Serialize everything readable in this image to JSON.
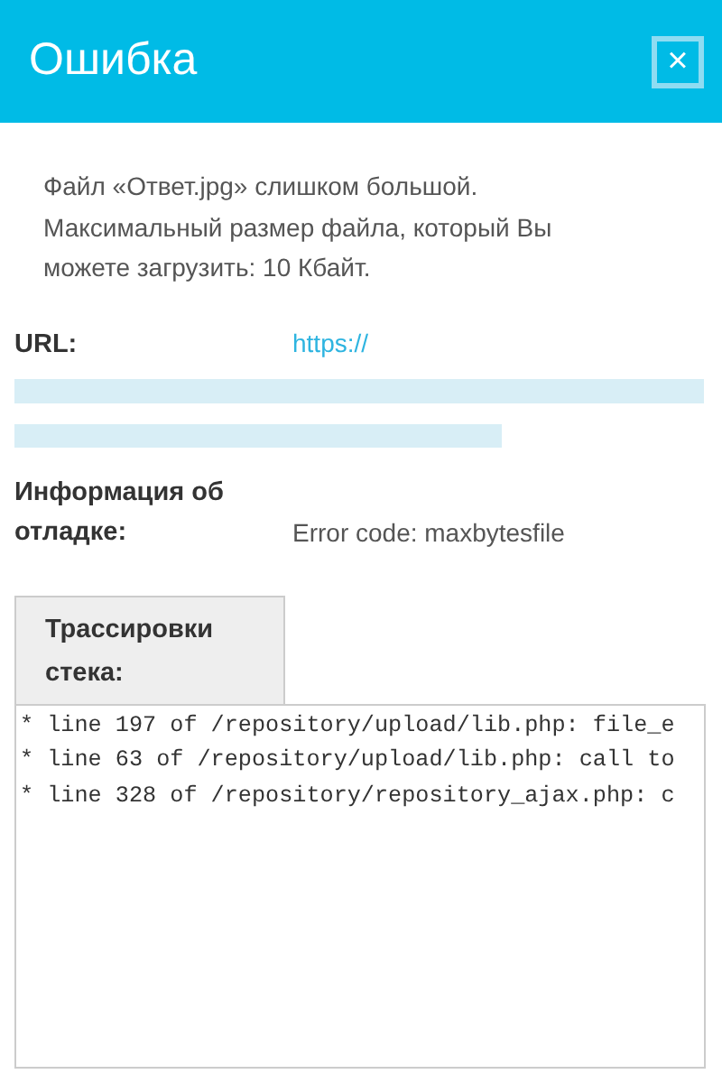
{
  "window": {
    "title": "Ошибка",
    "close": "×"
  },
  "message": [
    "Файл «Ответ.jpg» слишком большой.",
    "Максимальный размер файла, который Вы",
    "можете загрузить: 10 Кбайт."
  ],
  "fields": [
    {
      "label": "URL:",
      "value": "https://",
      "kind": "link",
      "redacted": true
    },
    {
      "label": "Информация об отладке:",
      "value": "Error code: maxbytesfile",
      "kind": "text",
      "redacted": false
    }
  ],
  "stack_trace": {
    "tab": "Трассировки стека:",
    "lines": [
      "* line 197 of /repository/upload/lib.php: file_e",
      "* line 63 of /repository/upload/lib.php: call to",
      "* line 328 of /repository/repository_ajax.php: c"
    ]
  }
}
